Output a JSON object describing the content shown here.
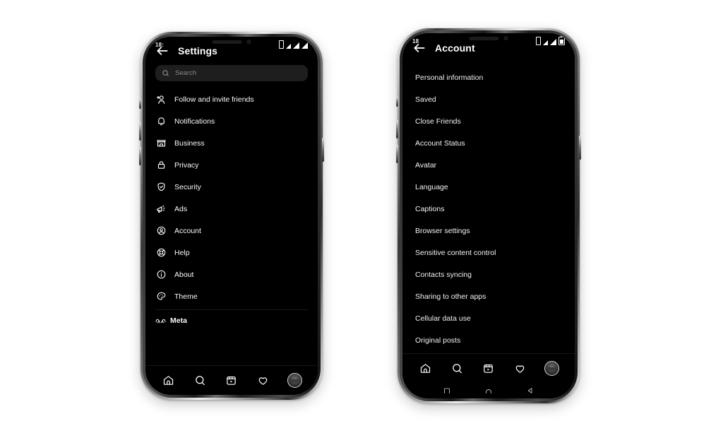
{
  "page": {
    "background": "#ffffff",
    "screen_background": "#000000"
  },
  "phones": [
    {
      "id": "left",
      "status_bar": {
        "time": "18:",
        "icons": [
          "vibrate-icon",
          "signal-icon",
          "signal-icon",
          "signal-icon"
        ]
      },
      "header": {
        "back_icon": "arrow-left-icon",
        "title": "Settings"
      },
      "search": {
        "icon": "search-icon",
        "placeholder": "Search",
        "value": ""
      },
      "menu_items": [
        {
          "label": "Follow and invite friends",
          "icon": "person-add-icon"
        },
        {
          "label": "Notifications",
          "icon": "bell-icon"
        },
        {
          "label": "Business",
          "icon": "store-icon"
        },
        {
          "label": "Privacy",
          "icon": "lock-icon"
        },
        {
          "label": "Security",
          "icon": "shield-check-icon"
        },
        {
          "label": "Ads",
          "icon": "megaphone-icon"
        },
        {
          "label": "Account",
          "icon": "person-circle-icon"
        },
        {
          "label": "Help",
          "icon": "lifebuoy-icon"
        },
        {
          "label": "About",
          "icon": "info-circle-icon"
        },
        {
          "label": "Theme",
          "icon": "palette-icon"
        }
      ],
      "footer_brand": {
        "label": "Meta",
        "icon": "meta-infinity-icon"
      },
      "tabbar": [
        {
          "name": "home",
          "icon": "home-icon"
        },
        {
          "name": "search",
          "icon": "search-icon"
        },
        {
          "name": "reels",
          "icon": "reels-icon"
        },
        {
          "name": "activity",
          "icon": "heart-icon"
        },
        {
          "name": "profile",
          "icon": "avatar-icon"
        }
      ],
      "android_nav": []
    },
    {
      "id": "right",
      "status_bar": {
        "time": "18",
        "icons": [
          "vibrate-icon",
          "signal-icon",
          "signal-icon",
          "battery-icon"
        ]
      },
      "header": {
        "back_icon": "arrow-left-icon",
        "title": "Account"
      },
      "list_items": [
        {
          "label": "Personal information"
        },
        {
          "label": "Saved"
        },
        {
          "label": "Close Friends"
        },
        {
          "label": "Account Status"
        },
        {
          "label": "Avatar"
        },
        {
          "label": "Language"
        },
        {
          "label": "Captions"
        },
        {
          "label": "Browser settings"
        },
        {
          "label": "Sensitive content control"
        },
        {
          "label": "Contacts syncing"
        },
        {
          "label": "Sharing to other apps"
        },
        {
          "label": "Cellular data use"
        },
        {
          "label": "Original posts"
        }
      ],
      "tabbar": [
        {
          "name": "home",
          "icon": "home-icon"
        },
        {
          "name": "search",
          "icon": "search-icon"
        },
        {
          "name": "reels",
          "icon": "reels-icon"
        },
        {
          "name": "activity",
          "icon": "heart-icon"
        },
        {
          "name": "profile",
          "icon": "avatar-icon"
        }
      ],
      "android_nav": [
        {
          "name": "recents",
          "icon": "square-icon"
        },
        {
          "name": "home",
          "icon": "circle-icon"
        },
        {
          "name": "back",
          "icon": "triangle-back-icon"
        }
      ]
    }
  ]
}
